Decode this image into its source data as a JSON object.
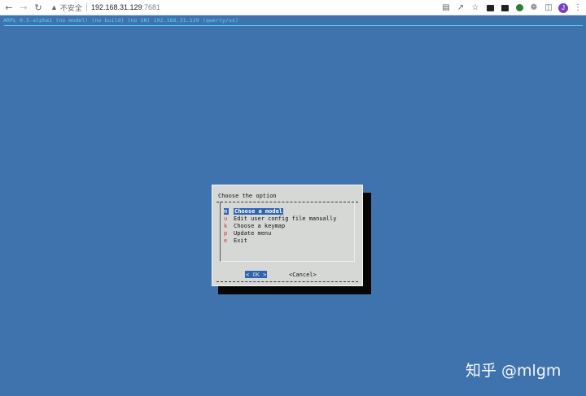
{
  "browser": {
    "insecure_label": "不安全",
    "url_host": "192.168.31.129",
    "url_port": ":7681",
    "avatar_letter": "J"
  },
  "terminal": {
    "status_line": "ARPL 0.5-alpha1 (no model) (no build) (no SN) 192.168.31.129 (qwerty/us)"
  },
  "dialog": {
    "title": "Choose the option",
    "items": [
      {
        "key": "m",
        "label": "Choose a model",
        "selected": true
      },
      {
        "key": "u",
        "label": "Edit user config file manually",
        "selected": false
      },
      {
        "key": "k",
        "label": "Choose a keymap",
        "selected": false
      },
      {
        "key": "p",
        "label": "Update menu",
        "selected": false
      },
      {
        "key": "e",
        "label": "Exit",
        "selected": false
      }
    ],
    "ok_left": "<",
    "ok_label": "OK",
    "ok_right": ">",
    "cancel_label": "<Cancel>"
  },
  "watermark": "知乎 @mlgm",
  "colors": {
    "terminal_bg": "#3f73ad",
    "status_text": "#59d3ff",
    "dialog_bg": "#d6d8d6",
    "selection": "#2f64b4",
    "hotkey": "#c0392b"
  }
}
